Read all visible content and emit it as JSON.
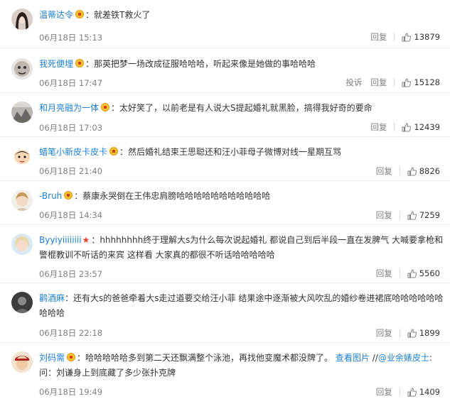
{
  "ui": {
    "reply_label": "回复",
    "report_label": "投诉",
    "colon": "："
  },
  "comments": [
    {
      "username": "温蒂达令",
      "text": "就差铁T救火了",
      "time": "06月18日 15:13",
      "likes": "13879"
    },
    {
      "username": "我死便埋",
      "text": "那英把梦一场改成征服哈哈哈，听起来像是她做的事哈哈哈",
      "time": "06月18日 17:47",
      "likes": "15128"
    },
    {
      "username": "和月亮融为一体",
      "text": "太好笑了，以前老是有人说大S提起婚礼就黑脸，搞得我好奇的要命",
      "time": "06月18日 17:03",
      "likes": "12439"
    },
    {
      "username": "蜡笔小新皮卡皮卡",
      "text": "然后婚礼结束王思聪还和汪小菲母子微博对线一星期互骂",
      "time": "06月18日 21:40",
      "likes": "8826"
    },
    {
      "username": "-Bruh",
      "text": "蔡康永哭倒在王伟忠肩膀哈哈哈哈哈哈哈哈哈哈哈",
      "time": "06月18日 14:34",
      "likes": "7259"
    },
    {
      "username": "Byyiyiiiiiiii",
      "text": "hhhhhhhh终于理解大s为什么每次说起婚礼 都说自己到后半段一直在发脾气 大喊要拿枪和警棍教训不听话的来宾 这样看 大家真的都很不听话哈哈哈哈哈",
      "time": "06月18日 23:57",
      "likes": "5560"
    },
    {
      "username": "鹳酒麻",
      "text": "还有大s的爸爸牵着大s走过道要交给汪小菲 结果途中逐渐被大风吹乱的婚纱卷进裙底哈哈哈哈哈哈哈哈哈",
      "time": "06月18日 22:18",
      "likes": "1899"
    },
    {
      "username": "刘码需",
      "text": "哈哈哈哈哈多到第二天还飘满整个泳池，再找他变魔术都没牌了。",
      "link1": "查看图片",
      "sep": "//",
      "mention": "@业余婊皮士",
      "text2": ":问：刘谦身上到底藏了多少张扑克牌",
      "time": "06月18日 19:49",
      "likes": "1409"
    }
  ]
}
